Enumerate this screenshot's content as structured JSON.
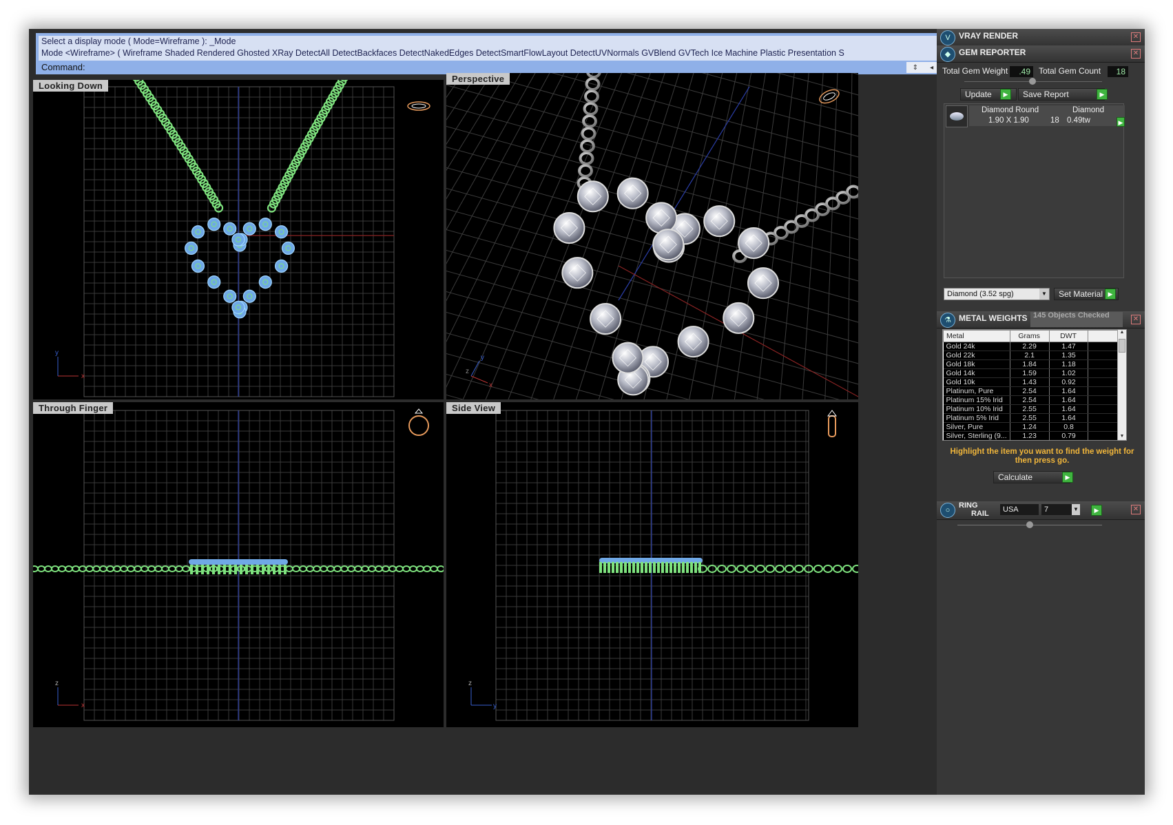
{
  "command": {
    "history_line1": "Select a display mode ( Mode=Wireframe ): _Mode",
    "history_line2": "Mode <Wireframe> ( Wireframe  Shaded  Rendered  Ghosted  XRay  DetectAll  DetectBackfaces  DetectNakedEdges  DetectSmartFlowLayout  DetectUVNormals  GVBlend  GVTech  Ice  Machine  Plastic  Presentation  S",
    "prompt": "Command:",
    "input_value": ""
  },
  "viewports": {
    "top_left": "Looking Down",
    "top_right": "Perspective",
    "bottom_left": "Through Finger",
    "bottom_right": "Side View"
  },
  "axes": {
    "looking_down": [
      "x",
      "y"
    ],
    "perspective": [
      "y",
      "z",
      "x"
    ],
    "through_finger": [
      "x",
      "z"
    ],
    "side_view": [
      "y",
      "z"
    ]
  },
  "panel": {
    "vray": {
      "title": "VRAY RENDER",
      "icon": "vray-icon"
    },
    "gem_reporter": {
      "title": "GEM REPORTER",
      "icon": "gem-icon",
      "total_gem_weight_label": "Total Gem Weight",
      "total_gem_weight": ".49",
      "total_gem_count_label": "Total Gem Count",
      "total_gem_count": "18",
      "update_label": "Update",
      "save_report_label": "Save Report",
      "gem_row": {
        "shape": "Diamond Round",
        "material": "Diamond",
        "size": "1.90 X 1.90",
        "count": "18",
        "weight": "0.49tw"
      },
      "material_select": "Diamond     (3.52 spg)",
      "set_material_label": "Set Material"
    },
    "metal_weights": {
      "title": "METAL WEIGHTS",
      "objects_checked": "145 Objects Checked",
      "columns": [
        "Metal",
        "Grams",
        "DWT"
      ],
      "rows": [
        [
          "Gold 24k",
          "2.29",
          "1.47"
        ],
        [
          "Gold 22k",
          "2.1",
          "1.35"
        ],
        [
          "Gold 18k",
          "1.84",
          "1.18"
        ],
        [
          "Gold 14k",
          "1.59",
          "1.02"
        ],
        [
          "Gold 10k",
          "1.43",
          "0.92"
        ],
        [
          "Platinum, Pure",
          "2.54",
          "1.64"
        ],
        [
          "Platinum 15% Irid",
          "2.54",
          "1.64"
        ],
        [
          "Platinum 10% Irid",
          "2.55",
          "1.64"
        ],
        [
          "Platinum 5% Irid",
          "2.55",
          "1.64"
        ],
        [
          "Silver, Pure",
          "1.24",
          "0.8"
        ],
        [
          "Silver, Sterling (9...",
          "1.23",
          "0.79"
        ]
      ],
      "instruction": "Highlight the item you want to find the weight for then press go.",
      "calculate_label": "Calculate"
    },
    "ring_rail": {
      "title_line1": "RING",
      "title_line2": "RAIL",
      "region": "USA",
      "size": "7"
    }
  },
  "colors": {
    "wire_green": "#7ee27e",
    "gem_blue": "#6fa8e6",
    "grid": "#3d3d3d",
    "accent_orange": "#f1b63b",
    "command_blue": "#8fb0e8"
  }
}
